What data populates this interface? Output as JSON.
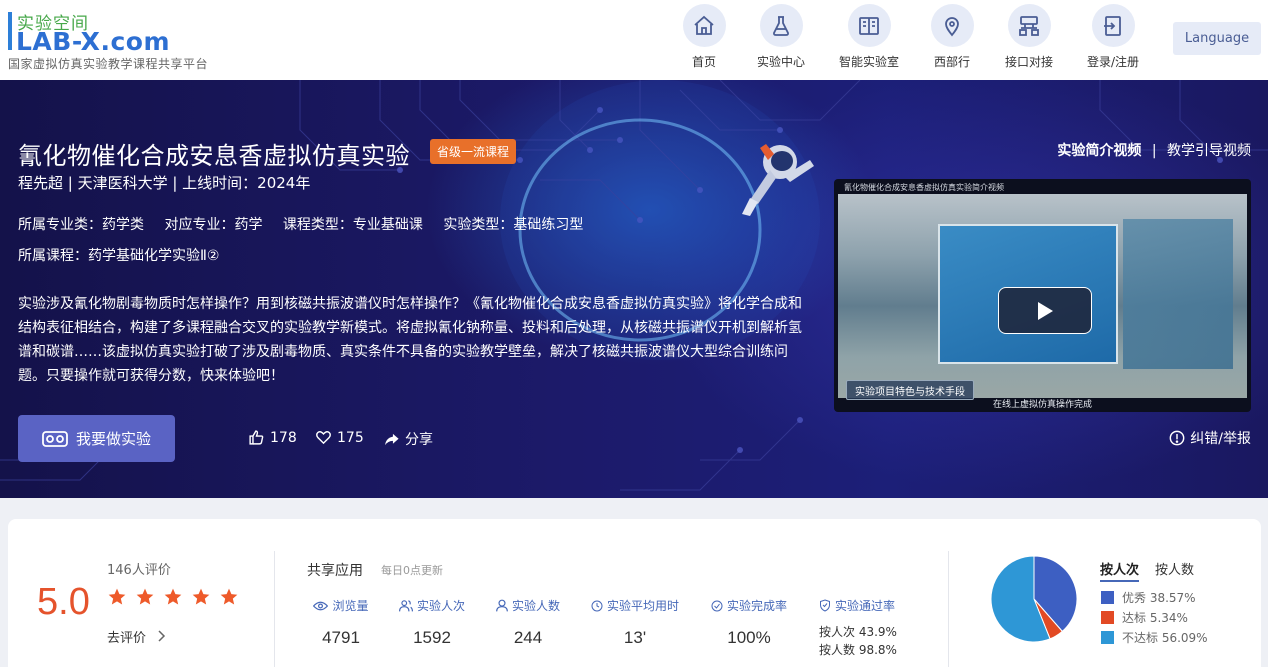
{
  "header": {
    "logo_cn": "实验空间",
    "logo_en": "LAB-X.com",
    "logo_sub": "国家虚拟仿真实验教学课程共享平台",
    "nav": [
      {
        "label": "首页",
        "icon": "home-icon"
      },
      {
        "label": "实验中心",
        "icon": "flask-icon"
      },
      {
        "label": "智能实验室",
        "icon": "book-icon"
      },
      {
        "label": "西部行",
        "icon": "map-pin-icon"
      },
      {
        "label": "接口对接",
        "icon": "network-icon"
      },
      {
        "label": "登录/注册",
        "icon": "login-icon"
      }
    ],
    "language_label": "Language"
  },
  "banner": {
    "title": "氰化物催化合成安息香虚拟仿真实验",
    "badge": "省级一流课程",
    "author": "程先超 | 天津医科大学 | 上线时间：2024年",
    "meta": {
      "major_category": "所属专业类：药学类",
      "major": "对应专业：药学",
      "course_type": "课程类型：专业基础课",
      "experiment_type": "实验类型：基础练习型",
      "course": "所属课程：药学基础化学实验Ⅱ②"
    },
    "description": "实验涉及氰化物剧毒物质时怎样操作？用到核磁共振波谱仪时怎样操作？《氰化物催化合成安息香虚拟仿真实验》将化学合成和结构表征相结合，构建了多课程融合交叉的实验教学新模式。将虚拟氰化钠称量、投料和后处理，从核磁共振谱仪开机到解析氢谱和碳谱……该虚拟仿真实验打破了涉及剧毒物质、真实条件不具备的实验教学壁垒，解决了核磁共振波谱仪大型综合训练问题。只要操作就可获得分数，快来体验吧！",
    "primary_button": "我要做实验",
    "likes": "178",
    "favorites": "175",
    "share": "分享",
    "video_tab_active": "实验简介视频",
    "video_tab_separator": "|",
    "video_tab_other": "教学引导视频",
    "video_caption_top": "氰化物催化合成安息香虚拟仿真实验简介视频",
    "video_caption_tag": "实验项目特色与技术手段",
    "video_caption_bottom": "在线上虚拟仿真操作完成",
    "report": "纠错/举报"
  },
  "stats": {
    "score": "5.0",
    "review_count": "146人评价",
    "stars": 5,
    "go_review": "去评价",
    "share_title": "共享应用",
    "share_note": "每日0点更新",
    "metrics": [
      {
        "label": "浏览量",
        "value": "4791",
        "icon": "eye-icon"
      },
      {
        "label": "实验人次",
        "value": "1592",
        "icon": "users-icon"
      },
      {
        "label": "实验人数",
        "value": "244",
        "icon": "user-icon"
      },
      {
        "label": "实验平均用时",
        "value": "13'",
        "icon": "clock-icon"
      },
      {
        "label": "实验完成率",
        "value": "100%",
        "icon": "check-circle-icon"
      },
      {
        "label": "实验通过率",
        "value": "",
        "icon": "shield-icon"
      }
    ],
    "pass_by_attempts": "按人次 43.9%",
    "pass_by_people": "按人数 98.8%",
    "tab_active": "按人次",
    "tab_other": "按人数",
    "legend": [
      {
        "label": "优秀 38.57%",
        "color": "#3d5fc2",
        "value": 38.57
      },
      {
        "label": "达标 5.34%",
        "color": "#e24a24",
        "value": 5.34
      },
      {
        "label": "不达标 56.09%",
        "color": "#2e97d6",
        "value": 56.09
      }
    ]
  }
}
